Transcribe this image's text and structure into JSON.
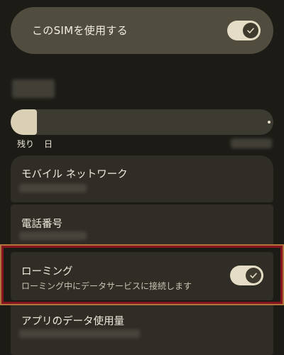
{
  "sim_toggle": {
    "label": "このSIMを使用する",
    "checked": true
  },
  "data_usage": {
    "fill_fraction": 0.1,
    "remaining_prefix": "残り",
    "remaining_suffix": "日"
  },
  "list": {
    "mobile_network": {
      "title": "モバイル ネットワーク"
    },
    "phone_number": {
      "title": "電話番号"
    },
    "roaming": {
      "title": "ローミング",
      "subtitle": "ローミング中にデータサービスに接続します",
      "checked": true
    },
    "app_data_usage": {
      "title": "アプリのデータ使用量"
    }
  },
  "colors": {
    "background": "#1c1b16",
    "card": "#514d3e",
    "row": "#2f2d26",
    "switch_track": "#e5ddc6",
    "switch_knob": "#3e3a2d",
    "highlight": "#86141f"
  },
  "icons": {
    "switch_check": "check-icon"
  }
}
